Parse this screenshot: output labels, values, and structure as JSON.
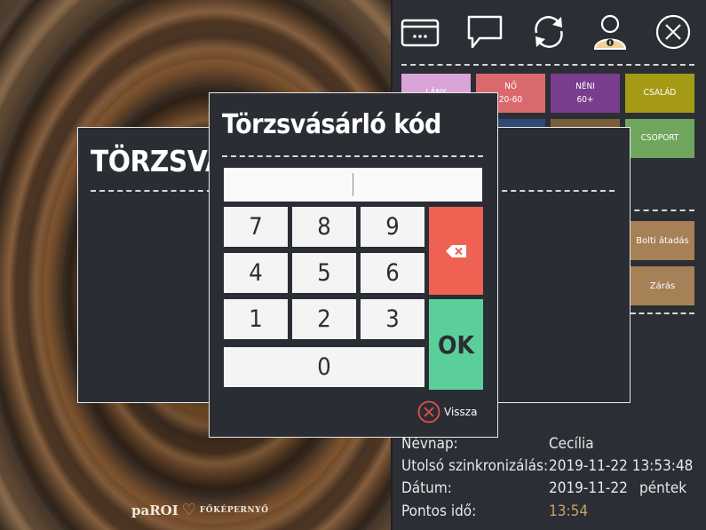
{
  "logo": {
    "brand": "paROI",
    "subtitle": "FŐKÉPERNYŐ"
  },
  "toolbar": {
    "icons": [
      "card-icon",
      "chat-icon",
      "sync-icon",
      "user-icon",
      "close-icon"
    ]
  },
  "categories": [
    {
      "name": "LÁNY",
      "sub": "",
      "color": "#d9a4d7"
    },
    {
      "name": "NŐ",
      "sub": "20-60",
      "color": "#d9696c"
    },
    {
      "name": "NÉNI",
      "sub": "60+",
      "color": "#7a3e8e"
    },
    {
      "name": "CSALÁD",
      "sub": "",
      "color": "#a59a16"
    },
    {
      "name": "CSOPORT",
      "sub": "",
      "color": "#6fa65c"
    }
  ],
  "side_buttons": [
    "Bolti átadás",
    "Zárás"
  ],
  "back_dialog": {
    "title": "TÖRZSVÁSÁ"
  },
  "front_dialog": {
    "title": "Törzsvásárló kód",
    "input_value": "",
    "keys": [
      "7",
      "8",
      "9",
      "4",
      "5",
      "6",
      "1",
      "2",
      "3",
      "0"
    ],
    "ok_label": "OK",
    "cancel_label": "Vissza"
  },
  "info": {
    "nameday_label": "Névnap:",
    "nameday_value": "Cecília",
    "sync_label": "Utolsó szinkronizálás:",
    "sync_value": "2019-11-22 13:53:48",
    "date_label": "Dátum:",
    "date_value": "2019-11-22",
    "weekday": "péntek",
    "time_label": "Pontos idő:",
    "time_value": "13:54",
    "time_color": "#c8a264"
  }
}
